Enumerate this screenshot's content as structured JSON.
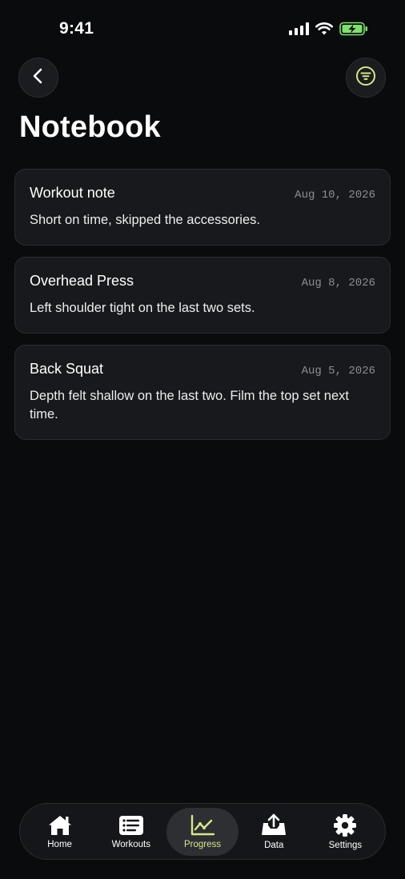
{
  "status_bar": {
    "time": "9:41"
  },
  "header": {
    "title": "Notebook",
    "back_icon": "chevron-left-icon",
    "filter_icon": "filter-lines-icon"
  },
  "notes": [
    {
      "title": "Workout note",
      "date": "Aug 10, 2026",
      "body": "Short on time, skipped the accessories."
    },
    {
      "title": "Overhead Press",
      "date": "Aug 8, 2026",
      "body": "Left shoulder tight on the last two sets."
    },
    {
      "title": "Back Squat",
      "date": "Aug 5, 2026",
      "body": "Depth felt shallow on the last two. Film the top set next time."
    }
  ],
  "tab_bar": {
    "items": [
      {
        "label": "Home",
        "icon": "home-icon"
      },
      {
        "label": "Workouts",
        "icon": "list-icon"
      },
      {
        "label": "Progress",
        "icon": "chart-line-icon",
        "active": true
      },
      {
        "label": "Data",
        "icon": "upload-tray-icon"
      },
      {
        "label": "Settings",
        "icon": "gear-icon"
      }
    ]
  },
  "colors": {
    "background": "#0a0b0d",
    "card": "#18191c",
    "accent": "#d6e78a",
    "battery": "#7ee06b"
  }
}
